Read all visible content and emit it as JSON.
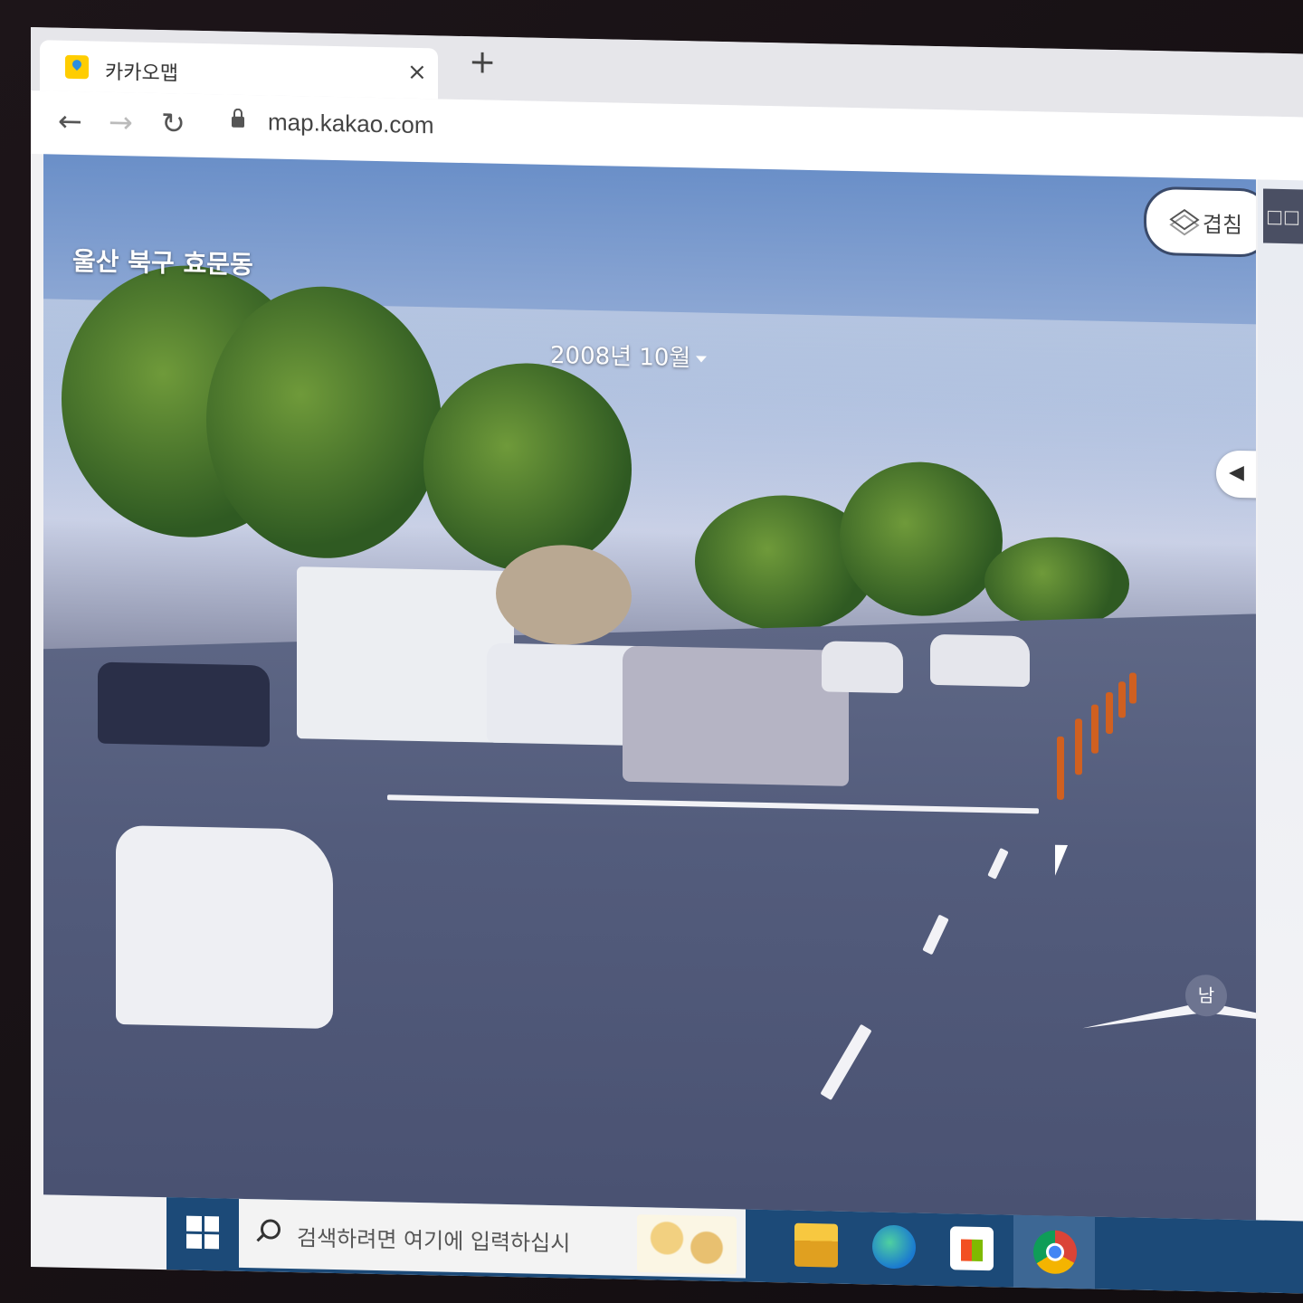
{
  "browser": {
    "tab_title": "카카오맵",
    "tab_close": "×",
    "new_tab": "+",
    "url": "map.kakao.com",
    "back": "←",
    "forward": "→",
    "reload": "↻"
  },
  "roadview": {
    "location": "울산 북구 효문동",
    "date": "2008년 10월",
    "overlay_button": "겹침",
    "side_tab": "□□",
    "compass_label": "남",
    "pager_prev": "◀",
    "pager_next": "▶"
  },
  "taskbar": {
    "search_placeholder": "검색하려면 여기에 입력하십시"
  }
}
